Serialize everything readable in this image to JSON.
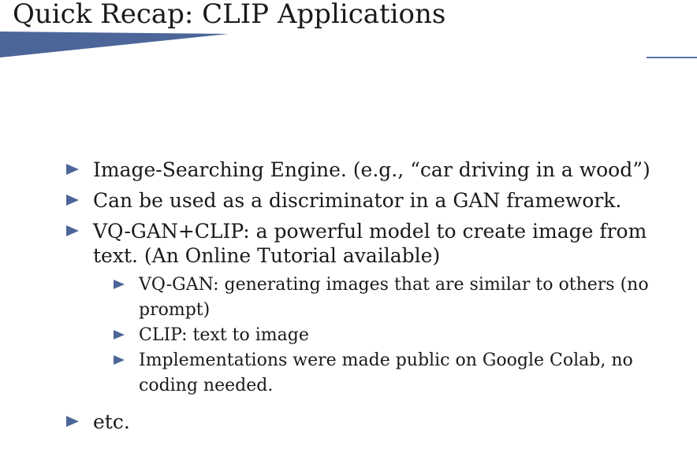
{
  "slide": {
    "title": "Quick Recap: CLIP Applications",
    "accent_color": "#4d6699"
  },
  "bullets": [
    {
      "text": "Image-Searching Engine. (e.g., “car driving in a wood”)",
      "icon": "triangle-bullet-icon"
    },
    {
      "text": "Can be used as a discriminator in a GAN framework.",
      "icon": "triangle-bullet-icon"
    },
    {
      "text": "VQ-GAN+CLIP: a powerful model to create image from text. (An Online Tutorial available)",
      "icon": "triangle-bullet-icon",
      "sub": [
        {
          "text": "VQ-GAN: generating images that are similar to others (no prompt)",
          "icon": "triangle-bullet-icon"
        },
        {
          "text": "CLIP: text to image",
          "icon": "triangle-bullet-icon"
        },
        {
          "text": "Implementations were made public on Google Colab, no coding needed.",
          "icon": "triangle-bullet-icon"
        }
      ]
    },
    {
      "text": "etc.",
      "icon": "triangle-bullet-icon"
    }
  ]
}
